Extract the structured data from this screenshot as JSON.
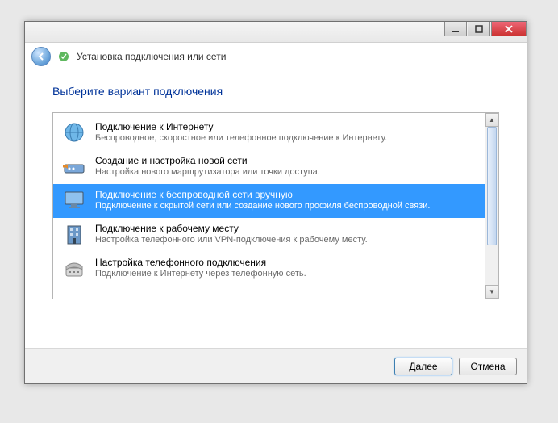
{
  "header": {
    "title": "Установка подключения или сети"
  },
  "heading": "Выберите вариант подключения",
  "options": [
    {
      "title": "Подключение к Интернету",
      "desc": "Беспроводное, скоростное или телефонное подключение к Интернету.",
      "icon": "globe"
    },
    {
      "title": "Создание и настройка новой сети",
      "desc": "Настройка нового маршрутизатора или точки доступа.",
      "icon": "router"
    },
    {
      "title": "Подключение к беспроводной сети вручную",
      "desc": "Подключение к скрытой сети или создание нового профиля беспроводной связи.",
      "icon": "monitor",
      "selected": true
    },
    {
      "title": "Подключение к рабочему месту",
      "desc": "Настройка телефонного или VPN-подключения к рабочему месту.",
      "icon": "building"
    },
    {
      "title": "Настройка телефонного подключения",
      "desc": "Подключение к Интернету через телефонную сеть.",
      "icon": "phone"
    }
  ],
  "buttons": {
    "next": "Далее",
    "cancel": "Отмена"
  }
}
